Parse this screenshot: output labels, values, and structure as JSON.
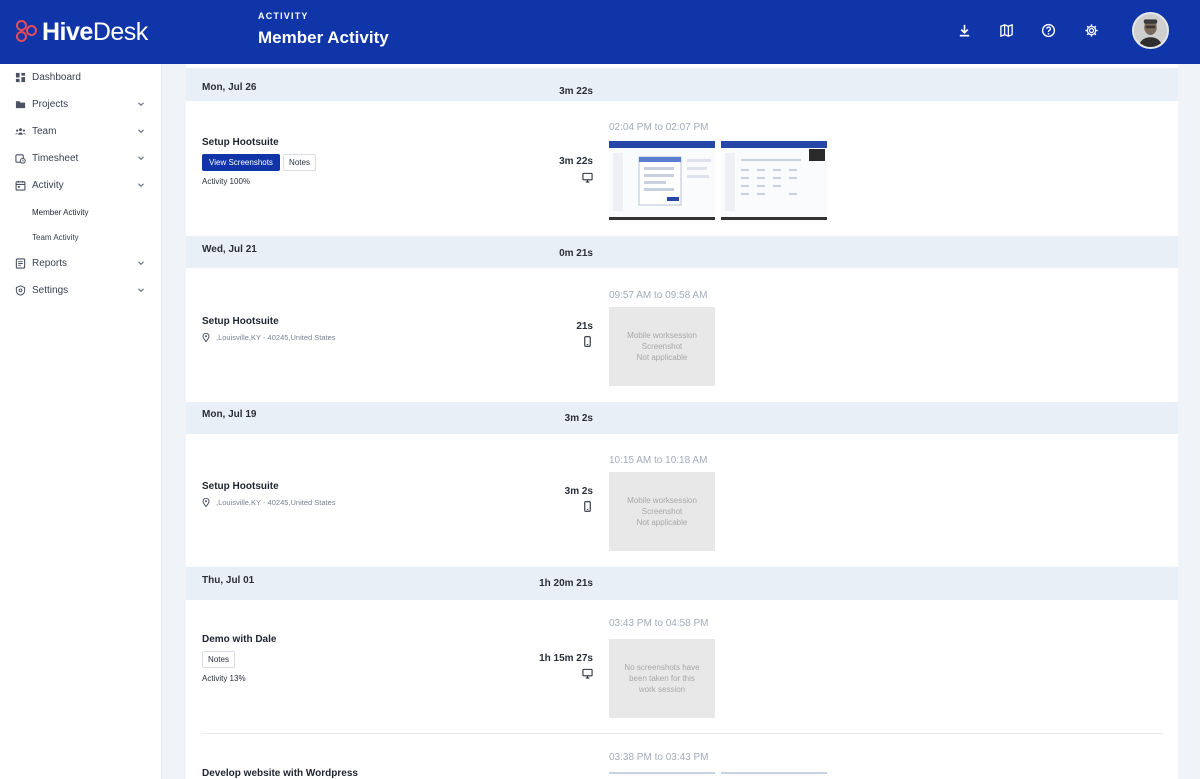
{
  "brand": {
    "name_bold": "Hive",
    "name_light": "Desk",
    "accent": "#e84b5a",
    "primary": "#0f35a8"
  },
  "header": {
    "section": "ACTIVITY",
    "title": "Member Activity",
    "icons": [
      "download-icon",
      "map-icon",
      "help-icon",
      "gear-icon"
    ]
  },
  "sidebar": {
    "items": [
      {
        "label": "Dashboard",
        "icon": "dashboard-icon",
        "expandable": false
      },
      {
        "label": "Projects",
        "icon": "folder-icon",
        "expandable": true
      },
      {
        "label": "Team",
        "icon": "team-icon",
        "expandable": true
      },
      {
        "label": "Timesheet",
        "icon": "timesheet-icon",
        "expandable": true
      },
      {
        "label": "Activity",
        "icon": "calendar-icon",
        "expandable": true
      },
      {
        "label": "Reports",
        "icon": "reports-icon",
        "expandable": true
      },
      {
        "label": "Settings",
        "icon": "settings-icon",
        "expandable": true
      }
    ],
    "activity_sub": [
      {
        "label": "Member Activity",
        "active": true
      },
      {
        "label": "Team Activity",
        "active": false
      }
    ]
  },
  "days": [
    {
      "date": "Mon, Jul 26",
      "total": "3m 22s",
      "entries": [
        {
          "title": "Setup Hootsuite",
          "view_screenshots": "View Screenshots",
          "notes": "Notes",
          "activity": "Activity 100%",
          "duration": "3m 22s",
          "device": "monitor-icon",
          "range": "02:04 PM to 02:07 PM"
        }
      ]
    },
    {
      "date": "Wed, Jul 21",
      "total": "0m 21s",
      "entries": [
        {
          "title": "Setup Hootsuite",
          "location": ",Louisville,KY - 40245,United States",
          "duration": "21s",
          "device": "mobile-icon",
          "range": "09:57 AM to 09:58 AM",
          "placeholder": [
            "Mobile worksession",
            "Screenshot",
            "Not applicable"
          ]
        }
      ]
    },
    {
      "date": "Mon, Jul 19",
      "total": "3m 2s",
      "entries": [
        {
          "title": "Setup Hootsuite",
          "location": ",Louisville,KY - 40245,United States",
          "duration": "3m 2s",
          "device": "mobile-icon",
          "range": "10:15 AM to 10:18 AM",
          "placeholder": [
            "Mobile worksession",
            "Screenshot",
            "Not applicable"
          ]
        }
      ]
    },
    {
      "date": "Thu, Jul 01",
      "total": "1h 20m 21s",
      "entries": [
        {
          "title": "Demo with Dale",
          "notes": "Notes",
          "activity": "Activity 13%",
          "duration": "1h 15m 27s",
          "device": "monitor-icon",
          "range": "03:43 PM to 04:58 PM",
          "placeholder": [
            "No screenshots have",
            "been taken for this",
            "work session"
          ]
        },
        {
          "title": "Develop website with Wordpress",
          "range": "03:38 PM to 03:43 PM"
        }
      ]
    }
  ]
}
